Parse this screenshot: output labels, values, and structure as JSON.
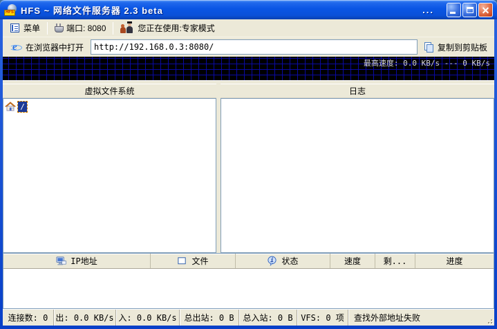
{
  "window": {
    "title": "HFS ~ 网络文件服务器 2.3 beta",
    "logo_text": "HFS",
    "title_dots": "..."
  },
  "toolbar": {
    "menu_label": "菜单",
    "port_label": "端口: 8080",
    "mode_label": "您正在使用:专家模式"
  },
  "browser_bar": {
    "open_label": "在浏览器中打开",
    "url_value": "http://192.168.0.3:8080/",
    "copy_label": "复制到剪贴板"
  },
  "graph": {
    "max_speed_label": "最高速度: 0.0 KB/s --- 0 KB/s"
  },
  "vfs_panel": {
    "header": "虚拟文件系统",
    "root_node": "/"
  },
  "log_panel": {
    "header": "日志"
  },
  "connections_table": {
    "columns": [
      "IP地址",
      "文件",
      "状态",
      "速度",
      "剩...",
      "进度"
    ]
  },
  "status_bar": {
    "segments": [
      "连接数: 0",
      "出: 0.0 KB/s",
      "入: 0.0 KB/s",
      "总出站: 0 B",
      "总入站: 0 B",
      "VFS: 0 项",
      "查找外部地址失败"
    ]
  },
  "colors": {
    "titlebar_blue": "#0A56E4",
    "window_border": "#0840C8",
    "toolbar_bg": "#ECE9D8",
    "sunken_border": "#7F9DB9",
    "selection_blue": "#1C3A96",
    "focus_dash_orange": "#D08000",
    "graph_bg": "#000000",
    "graph_grid": "#0A0AAA",
    "close_red": "#BC3410"
  }
}
